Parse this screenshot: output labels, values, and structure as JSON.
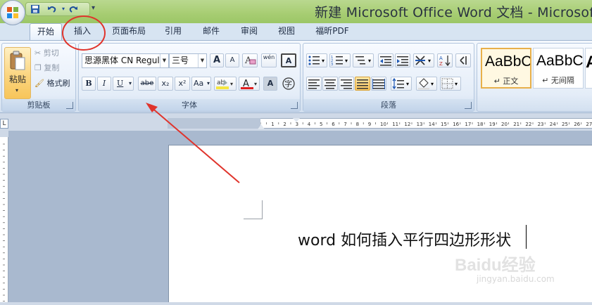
{
  "window": {
    "title": "新建 Microsoft Office Word 文档 - Microsof"
  },
  "quick_access": {
    "icons": [
      "save-icon",
      "undo-icon",
      "redo-icon",
      "customize-icon"
    ]
  },
  "tabs": [
    {
      "label": "开始",
      "active": true
    },
    {
      "label": "插入"
    },
    {
      "label": "页面布局"
    },
    {
      "label": "引用"
    },
    {
      "label": "邮件"
    },
    {
      "label": "审阅"
    },
    {
      "label": "视图"
    },
    {
      "label": "福昕PDF"
    }
  ],
  "ribbon": {
    "clipboard": {
      "group_label": "剪贴板",
      "paste": "粘贴",
      "cut": "剪切",
      "copy": "复制",
      "format_painter": "格式刷"
    },
    "font": {
      "group_label": "字体",
      "font_name": "思源黑体 CN Regul",
      "font_size": "三号",
      "grow": "A",
      "shrink": "A",
      "clear": "A",
      "bold": "B",
      "italic": "I",
      "underline": "U",
      "strike": "abe",
      "sub": "x₂",
      "sup": "x²",
      "case": "Aa",
      "phonetic": "wén",
      "char_border": "A",
      "enclose": "字"
    },
    "paragraph": {
      "group_label": "段落"
    },
    "styles": [
      {
        "sample": "AaBbC(",
        "name": "↵ 正文"
      },
      {
        "sample": "AaBbC(",
        "name": "↵ 无间隔"
      },
      {
        "sample": "A",
        "name": ""
      }
    ]
  },
  "ruler": {
    "corner": "L"
  },
  "document": {
    "text": "word 如何插入平行四边形形状"
  },
  "watermark": {
    "text": "Baidu经验",
    "sub": "jingyan.baidu.com"
  },
  "colors": {
    "annotation": "#e0342c",
    "accent": "#9bc667",
    "font_color": "#e02020",
    "highlight": "#f5e640"
  }
}
